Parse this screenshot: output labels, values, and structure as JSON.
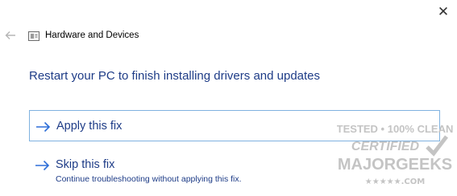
{
  "window": {
    "title": "Hardware and Devices",
    "close_symbol": "✕",
    "back_icon": "back-arrow-icon",
    "app_icon": "hardware-devices-icon"
  },
  "heading": "Restart your PC to finish installing drivers and updates",
  "options": [
    {
      "label": "Apply this fix",
      "icon": "arrow-right-icon",
      "highlighted": true
    },
    {
      "label": "Skip this fix",
      "description": "Continue troubleshooting without applying this fix.",
      "icon": "arrow-right-icon",
      "highlighted": false
    }
  ],
  "watermark": {
    "line1": "TESTED • 100% CLEAN",
    "line2": "CERTIFIED",
    "line3": "MAJORGEEKS",
    "line4": "★★★★★.COM"
  },
  "colors": {
    "link_blue": "#1e3c87",
    "arrow_blue": "#2e6fd8",
    "highlight_border": "#7fb2e0",
    "watermark_gray": "#c4c4c4"
  }
}
